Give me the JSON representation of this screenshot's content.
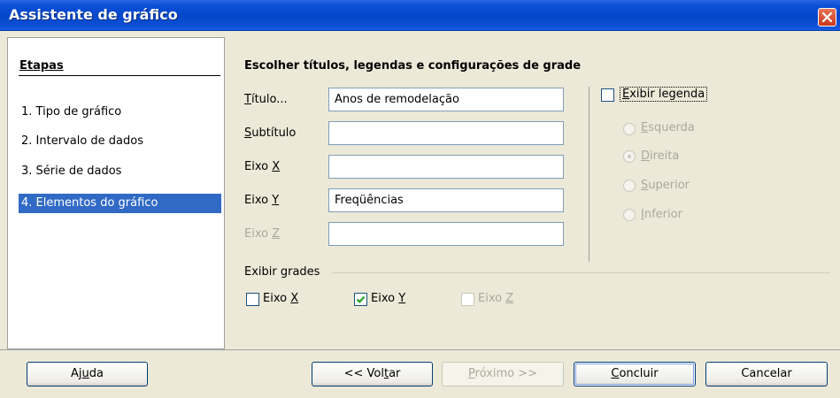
{
  "window": {
    "title": "Assistente de gráfico"
  },
  "steps": {
    "header": "Etapas",
    "items": [
      {
        "label": "1.  Tipo de gráfico"
      },
      {
        "label": "2.  Intervalo de dados"
      },
      {
        "label": "3.  Série de dados"
      },
      {
        "label": "4.  Elementos do gráfico",
        "selected": true
      }
    ]
  },
  "section_title": "Escolher títulos, legendas e configurações de grade",
  "fields": {
    "titulo": {
      "label_u": "T",
      "label_rest": "ítulo...",
      "value": "Anos de remodelação"
    },
    "subtitulo": {
      "label_u": "S",
      "label_rest": "ubtítulo",
      "value": ""
    },
    "eixo_x": {
      "label_pre": "Eixo ",
      "label_u": "X",
      "value": ""
    },
    "eixo_y": {
      "label_pre": "Eixo ",
      "label_u": "Y",
      "value": "Freqüências"
    },
    "eixo_z": {
      "label_pre": "Eixo ",
      "label_u": "Z",
      "value": "",
      "disabled": true
    }
  },
  "legend": {
    "checkbox_u": "E",
    "checkbox_rest": "xibir legenda",
    "checked": false,
    "positions": [
      {
        "u": "E",
        "rest": "squerda",
        "selected": false
      },
      {
        "u": "D",
        "rest": "ireita",
        "selected": true
      },
      {
        "u": "S",
        "rest": "uperior",
        "selected": false
      },
      {
        "u": "I",
        "rest": "nferior",
        "selected": false
      }
    ]
  },
  "grids": {
    "label": "Exibir grades",
    "x": {
      "pre": "Eixo ",
      "u": "X",
      "checked": false
    },
    "y": {
      "pre": "Eixo ",
      "u": "Y",
      "checked": true
    },
    "z": {
      "pre": "Eixo ",
      "u": "Z",
      "checked": false,
      "disabled": true
    }
  },
  "buttons": {
    "help": {
      "pre": "Aj",
      "u": "u",
      "post": "da"
    },
    "back": {
      "pre": "<< Vol",
      "u": "t",
      "post": "ar"
    },
    "next": {
      "pre": "",
      "u": "P",
      "post": "róximo >>",
      "disabled": true
    },
    "finish": {
      "pre": "",
      "u": "C",
      "post": "oncluir"
    },
    "cancel": {
      "label": "Cancelar"
    }
  },
  "colors": {
    "titlebar": "#0a4fd6",
    "selection": "#316ac5",
    "check": "#21a121",
    "face": "#ece9d8"
  }
}
